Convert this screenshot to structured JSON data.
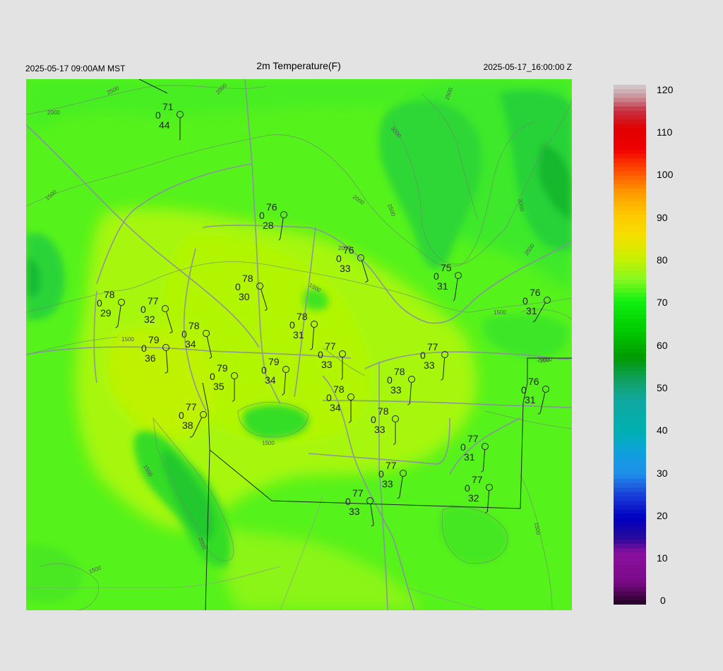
{
  "header": {
    "title": "2m Temperature(F)",
    "local_time": "2025-05-17 09:00AM MST",
    "utc_time": "2025-05-17_16:00:00 Z"
  },
  "colorbar": {
    "labels": [
      "120",
      "110",
      "100",
      "90",
      "80",
      "70",
      "60",
      "50",
      "40",
      "30",
      "20",
      "10",
      "0"
    ],
    "min": 0,
    "max": 120,
    "stops": [
      {
        "v": 0,
        "c": "#200020"
      },
      {
        "v": 5,
        "c": "#7a0a86"
      },
      {
        "v": 12,
        "c": "#8a10a0"
      },
      {
        "v": 15,
        "c": "#2a0a9a"
      },
      {
        "v": 20,
        "c": "#0000c0"
      },
      {
        "v": 25,
        "c": "#1a3ad8"
      },
      {
        "v": 30,
        "c": "#1e8ee8"
      },
      {
        "v": 35,
        "c": "#10a0e0"
      },
      {
        "v": 40,
        "c": "#00b0b0"
      },
      {
        "v": 47,
        "c": "#10a8a0"
      },
      {
        "v": 52,
        "c": "#10a060"
      },
      {
        "v": 57,
        "c": "#009a00"
      },
      {
        "v": 63,
        "c": "#00c800"
      },
      {
        "v": 70,
        "c": "#10f010"
      },
      {
        "v": 75,
        "c": "#88f820"
      },
      {
        "v": 80,
        "c": "#c8f000"
      },
      {
        "v": 85,
        "c": "#f4e000"
      },
      {
        "v": 90,
        "c": "#ffc800"
      },
      {
        "v": 95,
        "c": "#ff9c00"
      },
      {
        "v": 100,
        "c": "#ff5000"
      },
      {
        "v": 105,
        "c": "#f00000"
      },
      {
        "v": 110,
        "c": "#e00000"
      },
      {
        "v": 114,
        "c": "#c83040"
      },
      {
        "v": 117,
        "c": "#c89098"
      },
      {
        "v": 120,
        "c": "#d0d0d0"
      }
    ]
  },
  "contour_labels": [
    "2500",
    "2000",
    "2000",
    "3000",
    "2500",
    "2000",
    "1500",
    "3000",
    "2500",
    "2500",
    "2000",
    "1500",
    "1500",
    "1500",
    "1000",
    "1500",
    "2000",
    "1500",
    "2000",
    "1500",
    "1500",
    "2000"
  ],
  "stations": [
    {
      "temp": "71",
      "wind": "0",
      "dew": "44"
    },
    {
      "temp": "76",
      "wind": "0",
      "dew": "28"
    },
    {
      "temp": "76",
      "wind": "0",
      "dew": "33"
    },
    {
      "temp": "75",
      "wind": "0",
      "dew": "31"
    },
    {
      "temp": "78",
      "wind": "0",
      "dew": "30"
    },
    {
      "temp": "78",
      "wind": "0",
      "dew": "29"
    },
    {
      "temp": "77",
      "wind": "0",
      "dew": "32"
    },
    {
      "temp": "78",
      "wind": "0",
      "dew": "31"
    },
    {
      "temp": "76",
      "wind": "0",
      "dew": "31"
    },
    {
      "temp": "78",
      "wind": "0",
      "dew": "34"
    },
    {
      "temp": "79",
      "wind": "0",
      "dew": "36"
    },
    {
      "temp": "77",
      "wind": "0",
      "dew": "33"
    },
    {
      "temp": "77",
      "wind": "0",
      "dew": "33"
    },
    {
      "temp": "79",
      "wind": "0",
      "dew": "34"
    },
    {
      "temp": "79",
      "wind": "0",
      "dew": "35"
    },
    {
      "temp": "78",
      "wind": "0",
      "dew": "33"
    },
    {
      "temp": "76",
      "wind": "0",
      "dew": "31"
    },
    {
      "temp": "78",
      "wind": "0",
      "dew": "34"
    },
    {
      "temp": "78",
      "wind": "0",
      "dew": "33"
    },
    {
      "temp": "77",
      "wind": "0",
      "dew": "38"
    },
    {
      "temp": "77",
      "wind": "0",
      "dew": "31"
    },
    {
      "temp": "77",
      "wind": "0",
      "dew": "33"
    },
    {
      "temp": "77",
      "wind": "0",
      "dew": "32"
    },
    {
      "temp": "77",
      "wind": "0",
      "dew": "33"
    }
  ]
}
